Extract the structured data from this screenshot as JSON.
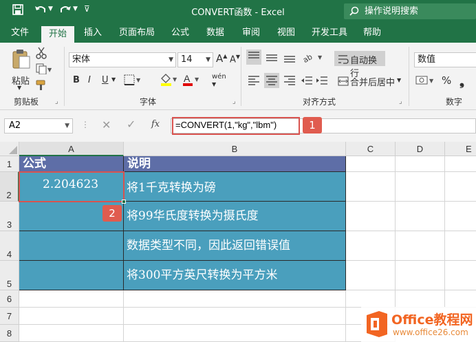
{
  "window": {
    "title": "CONVERT函数  -  Excel",
    "search_placeholder": "操作说明搜索"
  },
  "tabs": [
    "文件",
    "开始",
    "插入",
    "页面布局",
    "公式",
    "数据",
    "审阅",
    "视图",
    "开发工具",
    "帮助"
  ],
  "ribbon": {
    "clipboard": {
      "paste_label": "粘贴",
      "group_label": "剪贴板"
    },
    "font": {
      "font_name": "宋体",
      "font_size": "14",
      "group_label": "字体",
      "bold": "B",
      "italic": "I",
      "underline": "U",
      "phonetic": "wén"
    },
    "alignment": {
      "wrap_text": "自动换行",
      "merge_center": "合并后居中",
      "group_label": "对齐方式"
    },
    "number": {
      "format": "数值",
      "percent": "%",
      "group_label": "数字"
    }
  },
  "formula_bar": {
    "name_box": "A2",
    "fx": "fx",
    "formula": "=CONVERT(1,\"kg\",\"lbm\")"
  },
  "badges": {
    "one": "1",
    "two": "2"
  },
  "sheet": {
    "columns": [
      "A",
      "B",
      "C",
      "D",
      "E"
    ],
    "rows": [
      "1",
      "2",
      "3",
      "4",
      "5",
      "6",
      "7",
      "8"
    ],
    "header": {
      "a": "公式",
      "b": "说明"
    },
    "data": [
      {
        "a": "2.204623",
        "b": "将1千克转换为磅"
      },
      {
        "a": "",
        "b": "将99华氏度转换为摄氏度"
      },
      {
        "a": "",
        "b": "数据类型不同，因此返回错误值"
      },
      {
        "a": "",
        "b": "将300平方英尺转换为平方米"
      }
    ]
  },
  "watermark": {
    "brand": "Office教程网",
    "url": "www.office26.com"
  },
  "colors": {
    "excel_green": "#217346",
    "teal_fill": "#4a9fbd",
    "header_fill": "#5e6ea7",
    "highlight_red": "#d9534f",
    "watermark_orange": "#f26522"
  }
}
